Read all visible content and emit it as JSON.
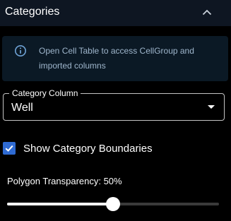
{
  "panel": {
    "title": "Categories",
    "collapse_icon": "chevron-up-icon"
  },
  "info": {
    "icon": "info-icon",
    "message": "Open Cell Table to access CellGroup and imported columns"
  },
  "category_select": {
    "label": "Category Column",
    "value": "Well",
    "icon": "dropdown-arrow-icon"
  },
  "boundaries_checkbox": {
    "label": "Show Category Boundaries",
    "checked": true
  },
  "transparency": {
    "label": "Polygon Transparency: 50%",
    "value_percent": 50
  },
  "colors": {
    "accent": "#2f6bd3",
    "header_bg": "#0e1622",
    "info_bg": "#0b1925",
    "info_text": "#9fb6cc"
  }
}
